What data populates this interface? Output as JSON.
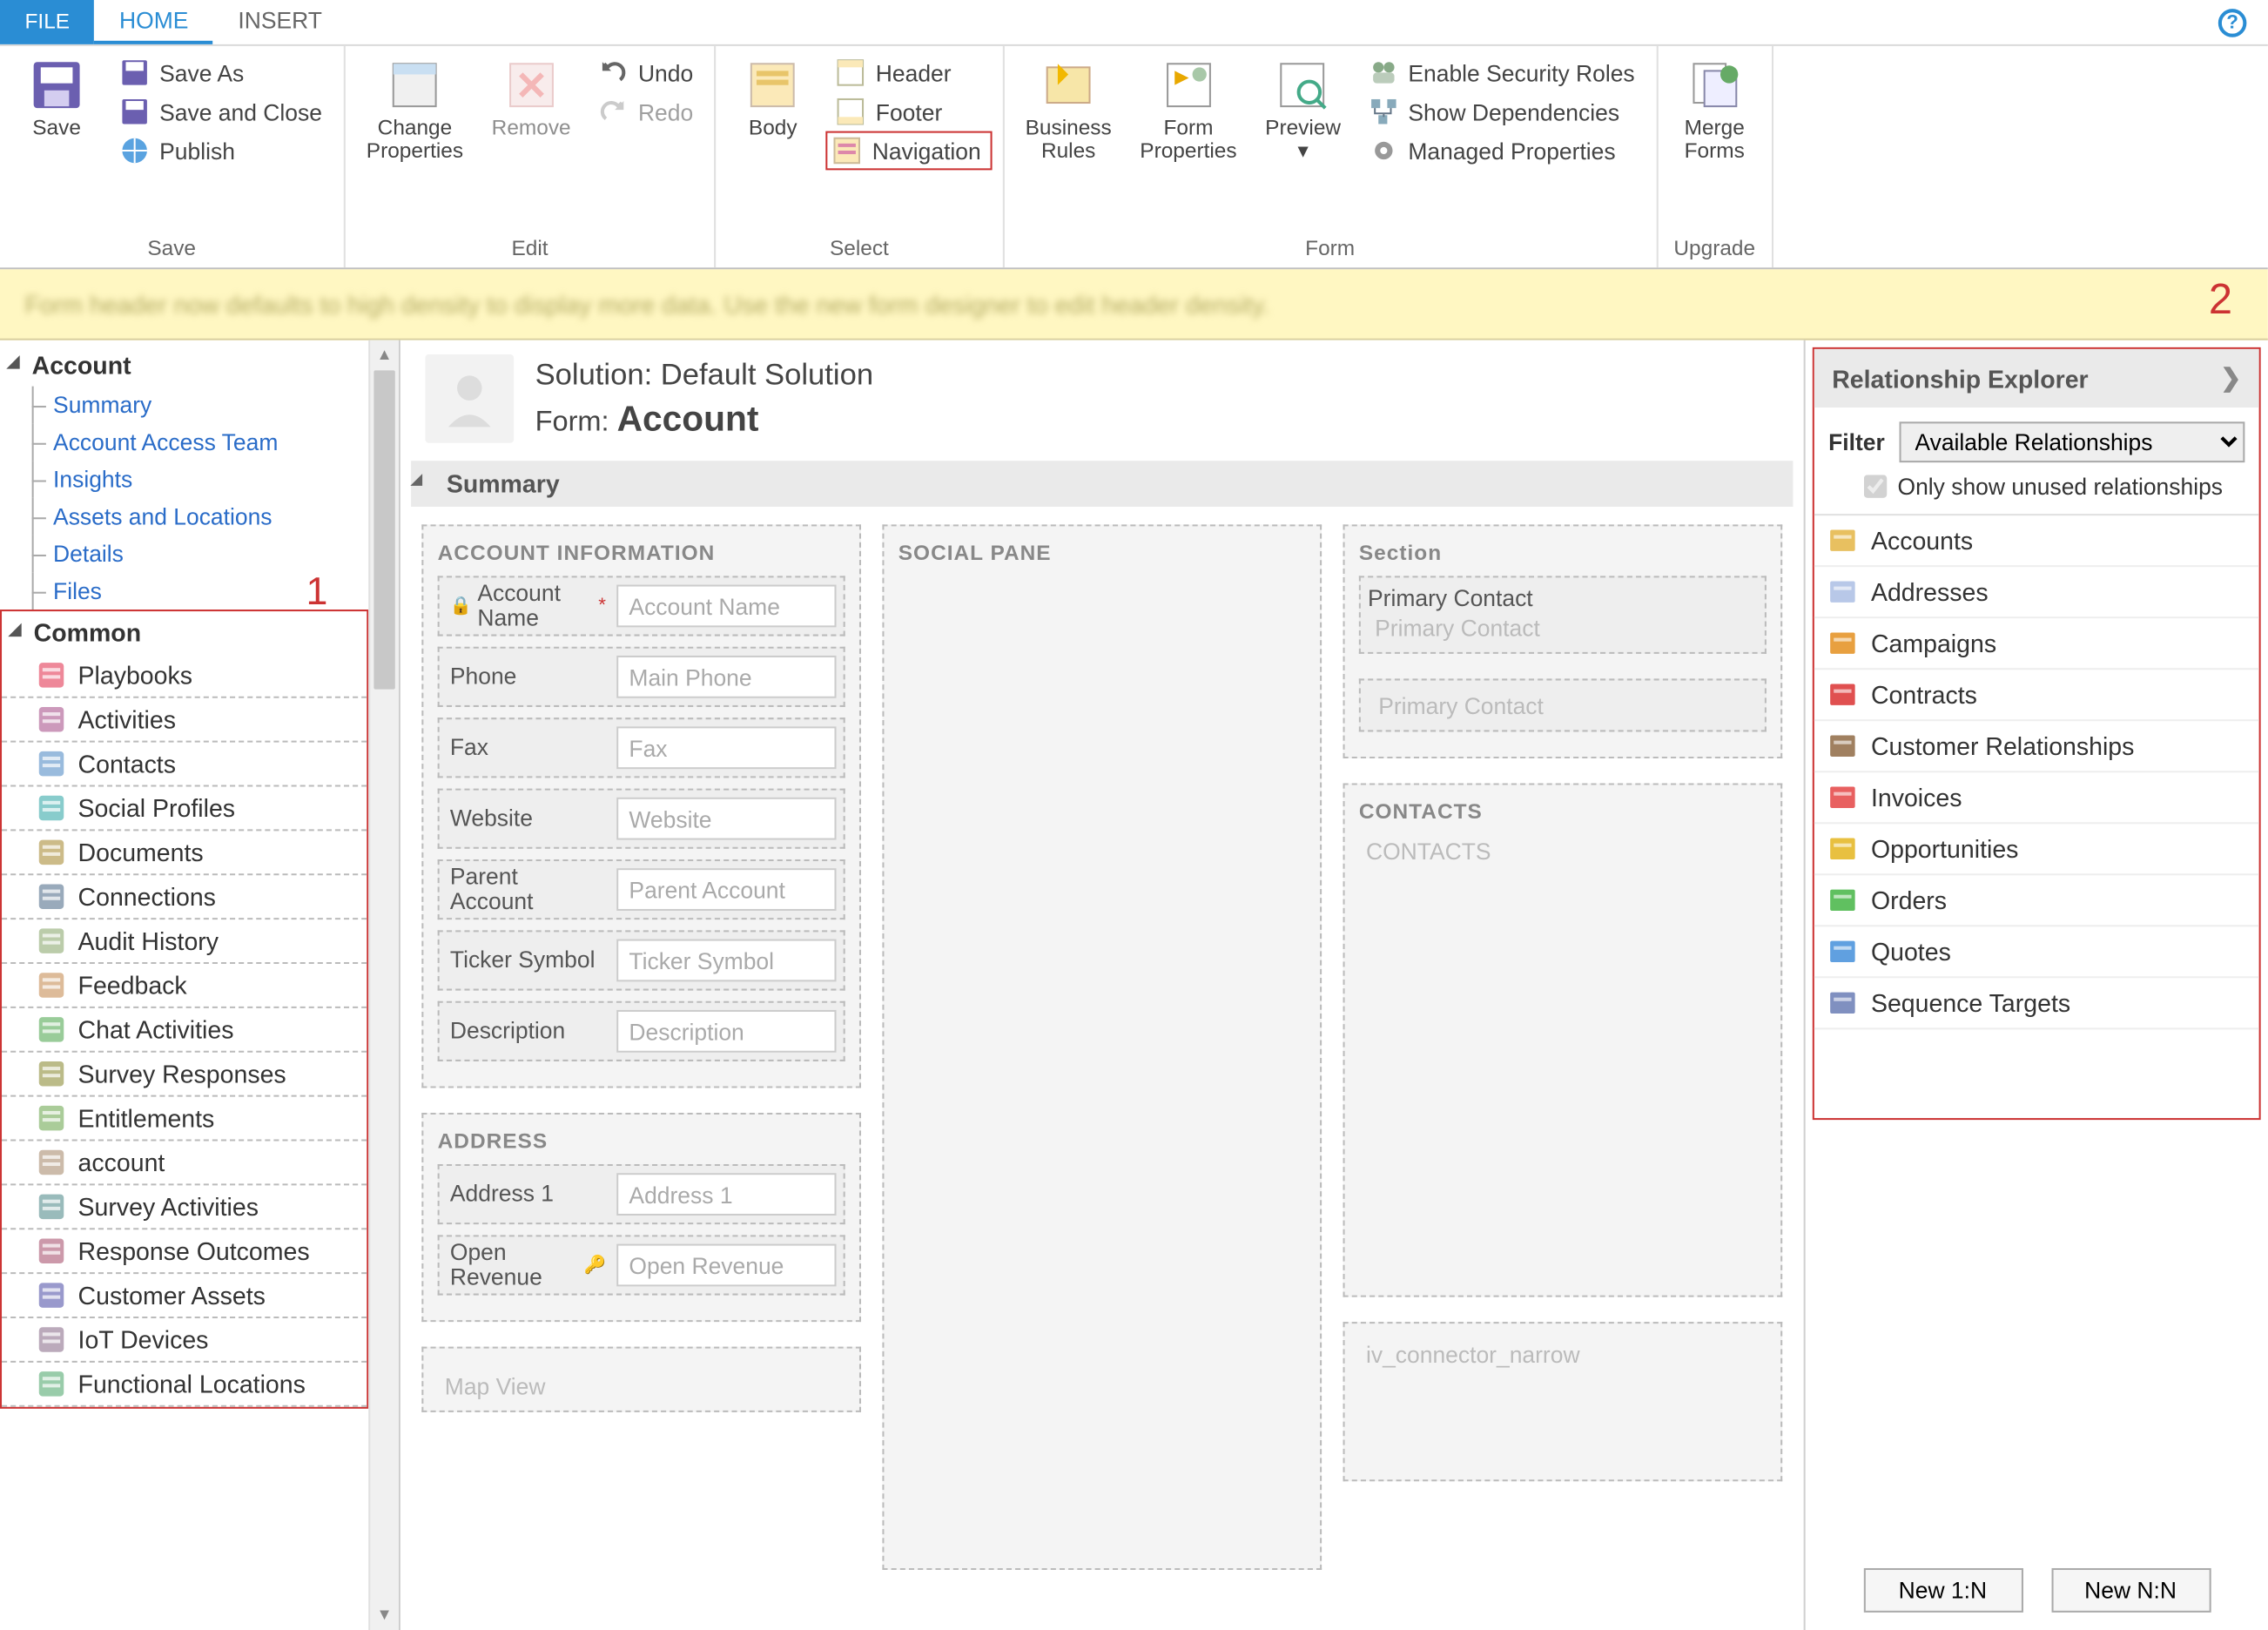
{
  "tabs": {
    "file": "FILE",
    "home": "HOME",
    "insert": "INSERT"
  },
  "ribbon": {
    "save_group": {
      "save": "Save",
      "save_as": "Save As",
      "save_close": "Save and Close",
      "publish": "Publish",
      "label": "Save"
    },
    "edit_group": {
      "change_props": "Change\nProperties",
      "remove": "Remove",
      "undo": "Undo",
      "redo": "Redo",
      "label": "Edit"
    },
    "select_group": {
      "body": "Body",
      "header": "Header",
      "footer": "Footer",
      "navigation": "Navigation",
      "label": "Select"
    },
    "form_group": {
      "biz_rules": "Business\nRules",
      "form_props": "Form\nProperties",
      "preview": "Preview",
      "sec_roles": "Enable Security Roles",
      "show_deps": "Show Dependencies",
      "managed": "Managed Properties",
      "label": "Form"
    },
    "upgrade_group": {
      "merge": "Merge\nForms",
      "label": "Upgrade"
    }
  },
  "infobar_text": "Form header now defaults to high density to display more data. Use the new form designer to edit header density.",
  "annotations": {
    "one": "1",
    "two": "2"
  },
  "tree": {
    "account": "Account",
    "items": [
      "Summary",
      "Account Access Team",
      "Insights",
      "Assets and Locations",
      "Details",
      "Files"
    ]
  },
  "common": {
    "header": "Common",
    "items": [
      "Playbooks",
      "Activities",
      "Contacts",
      "Social Profiles",
      "Documents",
      "Connections",
      "Audit History",
      "Feedback",
      "Chat Activities",
      "Survey Responses",
      "Entitlements",
      "account",
      "Survey Activities",
      "Response Outcomes",
      "Customer Assets",
      "IoT Devices",
      "Functional Locations"
    ]
  },
  "canvas": {
    "solution_label": "Solution: Default Solution",
    "form_label_prefix": "Form: ",
    "form_name": "Account",
    "summary": "Summary",
    "sec_account_info": "ACCOUNT INFORMATION",
    "sec_social": "SOCIAL PANE",
    "sec_section": "Section",
    "sec_contacts": "CONTACTS",
    "sec_address": "ADDRESS",
    "fields": {
      "account_name": {
        "label": "Account Name",
        "ph": "Account Name"
      },
      "phone": {
        "label": "Phone",
        "ph": "Main Phone"
      },
      "fax": {
        "label": "Fax",
        "ph": "Fax"
      },
      "website": {
        "label": "Website",
        "ph": "Website"
      },
      "parent": {
        "label": "Parent Account",
        "ph": "Parent Account"
      },
      "ticker": {
        "label": "Ticker Symbol",
        "ph": "Ticker Symbol"
      },
      "desc": {
        "label": "Description",
        "ph": "Description"
      },
      "address1": {
        "label": "Address 1",
        "ph": "Address 1"
      },
      "open_rev": {
        "label": "Open Revenue",
        "ph": "Open Revenue"
      },
      "map_view": {
        "label": "Map View"
      },
      "primary_contact": {
        "label": "Primary Contact",
        "ph": "Primary Contact"
      },
      "iv_conn": "iv_connector_narrow"
    },
    "contacts_ph": "CONTACTS"
  },
  "rel": {
    "title": "Relationship Explorer",
    "filter_label": "Filter",
    "filter_value": "Available Relationships",
    "checkbox": "Only show unused relationships",
    "items": [
      "Accounts",
      "Addresses",
      "Campaigns",
      "Contracts",
      "Customer Relationships",
      "Invoices",
      "Opportunities",
      "Orders",
      "Quotes",
      "Sequence Targets"
    ],
    "btn_1n": "New 1:N",
    "btn_nn": "New N:N"
  }
}
